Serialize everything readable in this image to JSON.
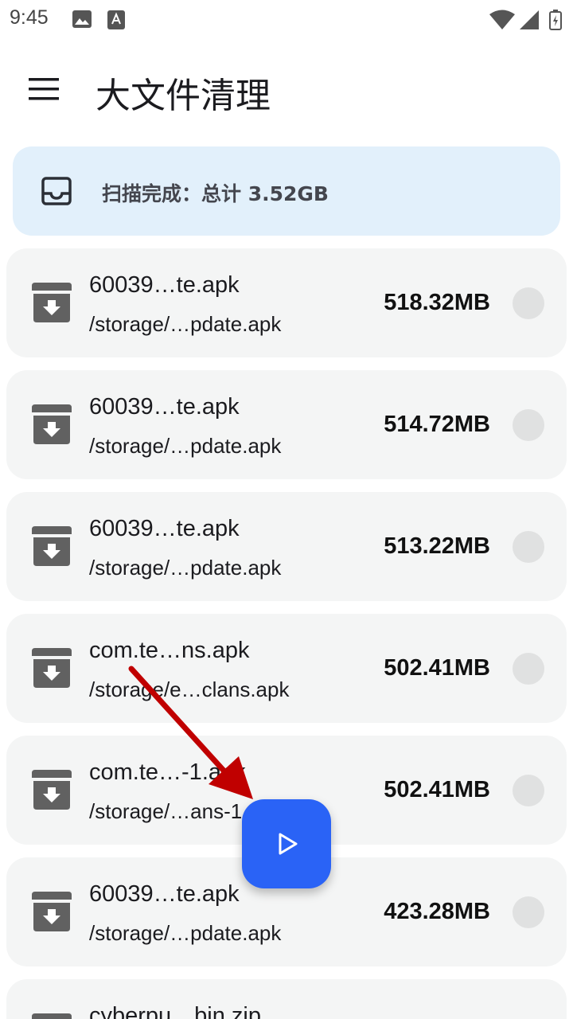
{
  "status_bar": {
    "time": "9:45"
  },
  "app_bar": {
    "title": "大文件清理"
  },
  "summary": {
    "text": "扫描完成：总计 3.52GB"
  },
  "files": [
    {
      "name": "60039…te.apk",
      "path": "/storage/…pdate.apk",
      "size": "518.32MB"
    },
    {
      "name": "60039…te.apk",
      "path": "/storage/…pdate.apk",
      "size": "514.72MB"
    },
    {
      "name": "60039…te.apk",
      "path": "/storage/…pdate.apk",
      "size": "513.22MB"
    },
    {
      "name": "com.te…ns.apk",
      "path": "/storage/e…clans.apk",
      "size": "502.41MB"
    },
    {
      "name": "com.te…-1.apk",
      "path": "/storage/…ans-1.apk",
      "size": "502.41MB"
    },
    {
      "name": "60039…te.apk",
      "path": "/storage/…pdate.apk",
      "size": "423.28MB"
    },
    {
      "name": "cyberpu…bin.zip",
      "path": "",
      "size": ""
    }
  ],
  "colors": {
    "accent": "#2a63f6",
    "summary_bg": "#e2f0fb",
    "card_bg": "#f4f5f5",
    "annotation": "#c00000"
  }
}
